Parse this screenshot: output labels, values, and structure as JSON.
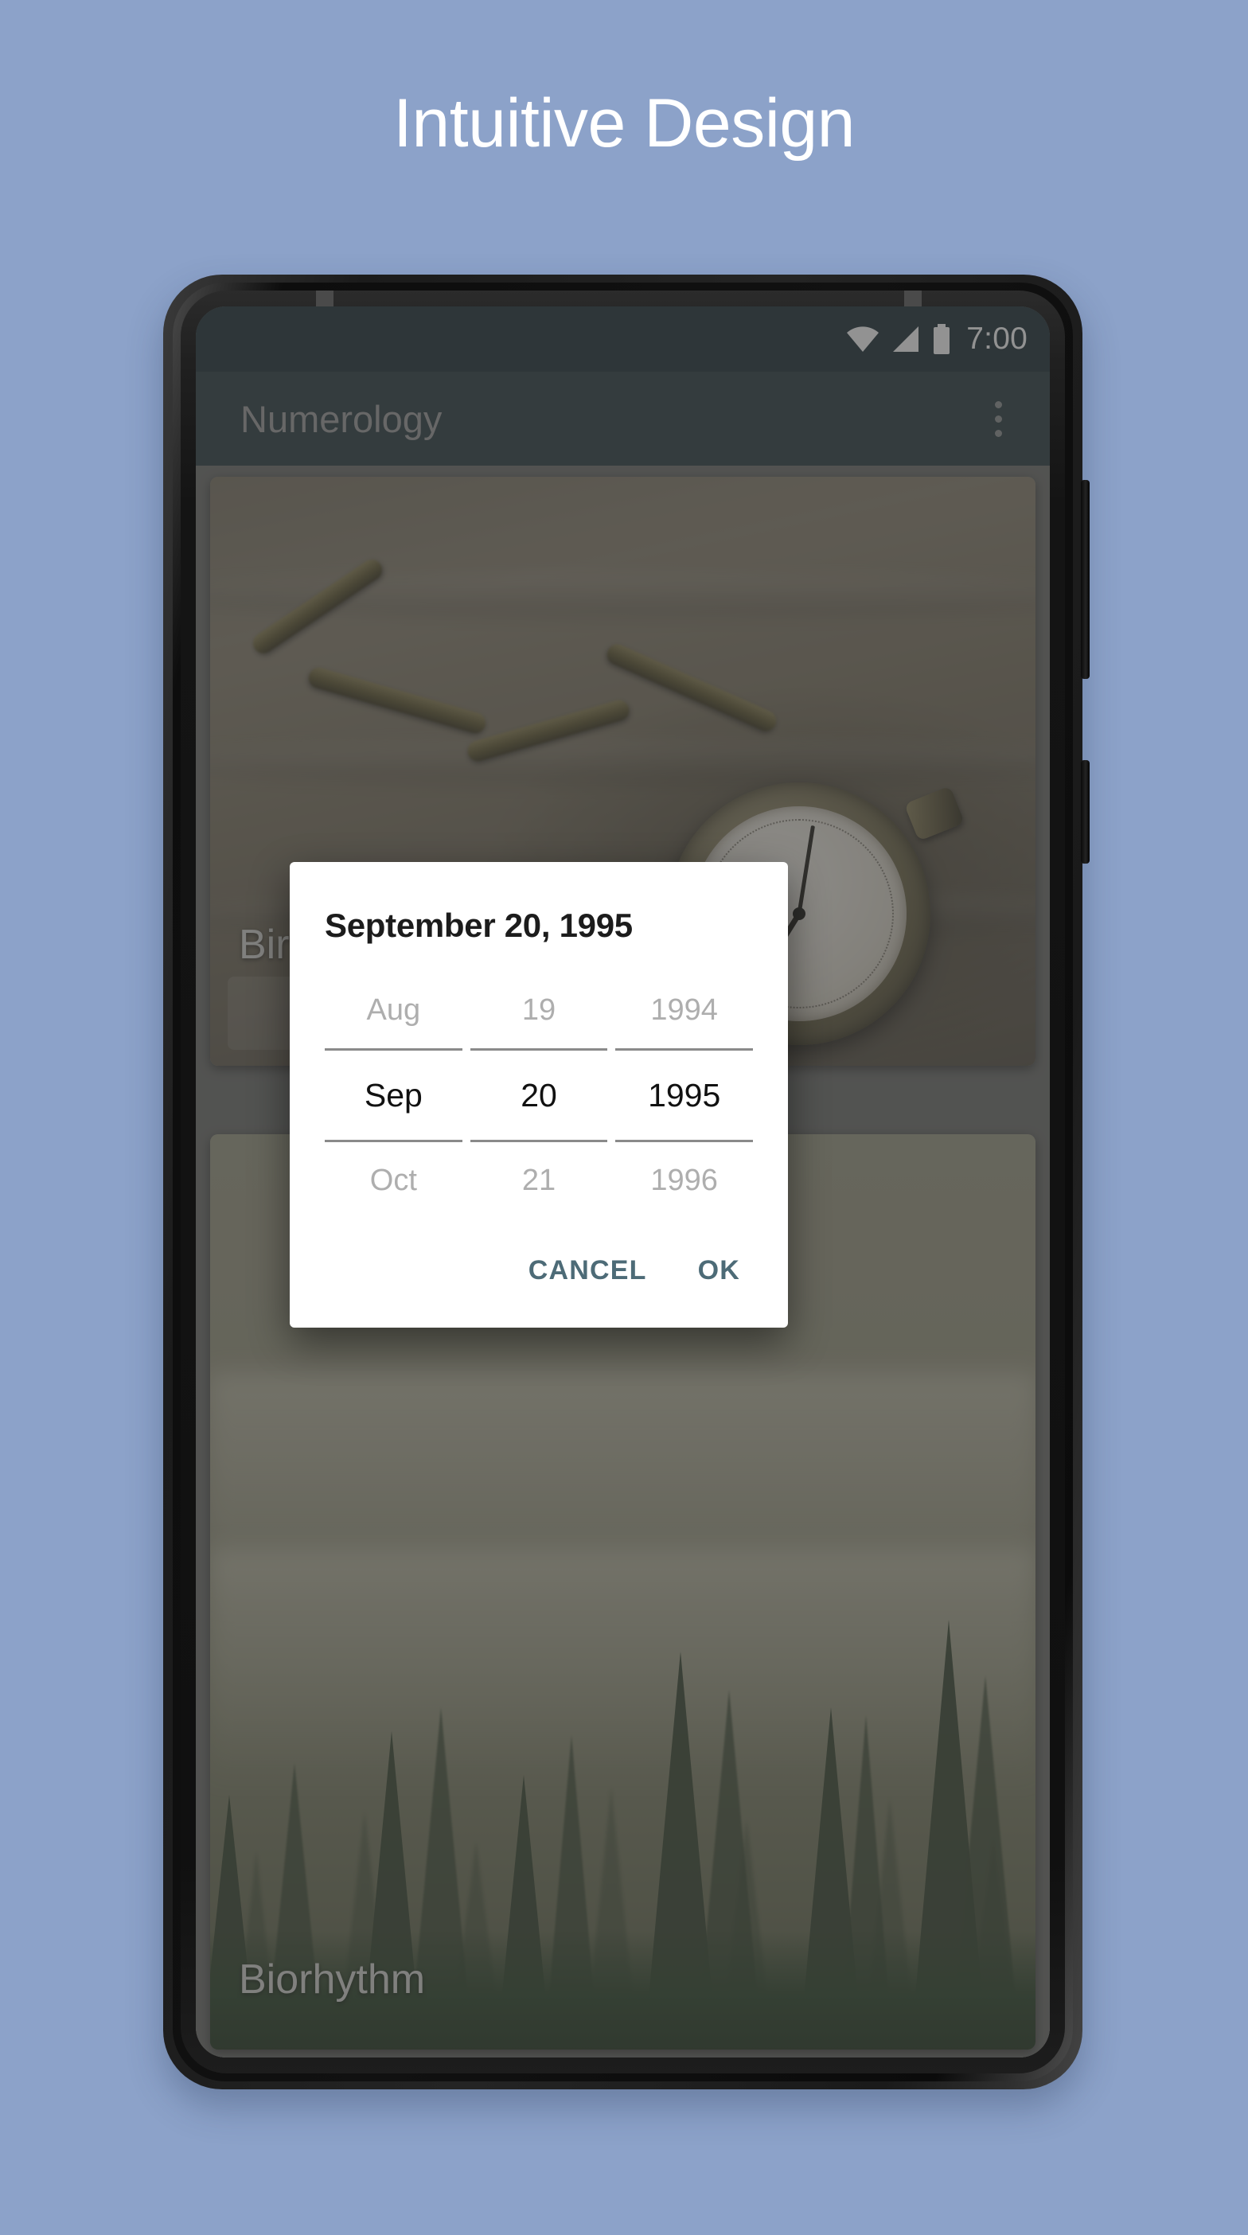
{
  "page": {
    "headline": "Intuitive Design",
    "background_color": "#8ca2c9"
  },
  "phone": {
    "status_bar": {
      "background_color": "#1c2f36",
      "time": "7:00",
      "icons": [
        "wifi-icon",
        "cell-signal-icon",
        "battery-icon"
      ]
    },
    "app_bar": {
      "title": "Numerology",
      "background_color": "#2b3c41",
      "overflow_menu": "more-options-icon"
    },
    "cards": [
      {
        "label": "Birthday Number",
        "image": "pocket-watch-in-sand"
      },
      {
        "label": "Biorhythm",
        "image": "misty-pine-forest"
      }
    ]
  },
  "dialog": {
    "title": "September 20, 1995",
    "accent_color": "#4d6b77",
    "month": {
      "previous": "Aug",
      "selected": "Sep",
      "next": "Oct"
    },
    "day": {
      "previous": "19",
      "selected": "20",
      "next": "21"
    },
    "year": {
      "previous": "1994",
      "selected": "1995",
      "next": "1996"
    },
    "cancel_label": "CANCEL",
    "ok_label": "OK"
  }
}
